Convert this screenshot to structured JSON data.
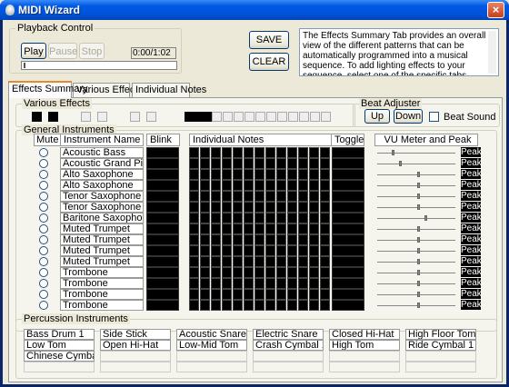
{
  "window": {
    "title": "MIDI Wizard",
    "close_label": "×"
  },
  "playback": {
    "group_label": "Playback Control",
    "play_label": "Play",
    "pause_label": "Pause",
    "stop_label": "Stop",
    "time": "0:00/1:02"
  },
  "buttons": {
    "save": "SAVE",
    "clear": "CLEAR"
  },
  "info_text": "The Effects Summary Tab provides an overall view of the different patterns that can be automatically programmed into a musical sequence. To add lighting effects to your sequence, select one of the specific tabs.",
  "tabs": [
    {
      "label": "Effects Summary",
      "active": true
    },
    {
      "label": "Various Effects",
      "active": false
    },
    {
      "label": "Individual Notes",
      "active": false
    }
  ],
  "various_effects": {
    "label": "Various Effects"
  },
  "beat_adjuster": {
    "label": "Beat Adjuster",
    "up": "Up",
    "down": "Down",
    "beat_sound": "Beat Sound"
  },
  "general": {
    "label": "General Instruments",
    "headers": {
      "mute": "Mute",
      "instrument": "Instrument Name",
      "blink": "Blink",
      "notes": "Individual Notes",
      "toggle": "Toggle",
      "vu": "VU Meter  and  Peak"
    },
    "peak_label": "Peak",
    "instruments": [
      "Acoustic Bass",
      "Acoustic Grand Piano",
      "Alto Saxophone",
      "Alto Saxophone",
      "Tenor Saxophone",
      "Tenor Saxophone",
      "Baritone Saxophone",
      "Muted Trumpet",
      "Muted Trumpet",
      "Muted Trumpet",
      "Muted Trumpet",
      "Trombone",
      "Trombone",
      "Trombone",
      "Trombone"
    ]
  },
  "percussion": {
    "label": "Percussion Instruments",
    "columns": [
      [
        "Bass Drum 1",
        "Low Tom",
        "Chinese Cymbal"
      ],
      [
        "Side Stick",
        "Open Hi-Hat"
      ],
      [
        "Acoustic Snare",
        "Low-Mid Tom"
      ],
      [
        "Electric Snare",
        "Crash Cymbal 1"
      ],
      [
        "Closed Hi-Hat",
        "High Tom"
      ],
      [
        "High Floor Tom",
        "Ride Cymbal 1"
      ]
    ]
  }
}
